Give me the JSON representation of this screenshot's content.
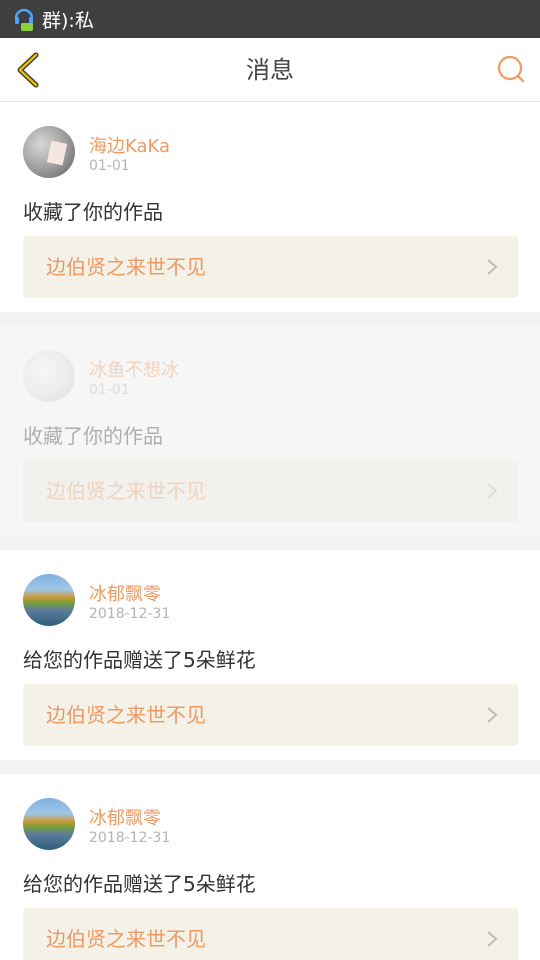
{
  "status_bar": {
    "text": "群):私"
  },
  "header": {
    "title": "消息"
  },
  "cards": [
    {
      "username": "海边KaKa",
      "date": "01-01",
      "message": "收藏了你的作品",
      "work_title": "边伯贤之来世不见"
    },
    {
      "username": "冰鱼不想冰",
      "date": "01-01",
      "message": "收藏了你的作品",
      "work_title": "边伯贤之来世不见"
    },
    {
      "username": "冰郁飘零",
      "date": "2018-12-31",
      "message": "给您的作品赠送了5朵鲜花",
      "work_title": "边伯贤之来世不见"
    },
    {
      "username": "冰郁飘零",
      "date": "2018-12-31",
      "message": "给您的作品赠送了5朵鲜花",
      "work_title": "边伯贤之来世不见"
    }
  ],
  "colors": {
    "accent": "#ef9a62",
    "back_arrow": "#e6b800",
    "link_bg": "#f3f1e8"
  }
}
